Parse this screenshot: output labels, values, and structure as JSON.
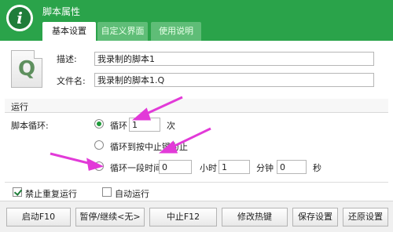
{
  "window": {
    "title": "脚本属性",
    "logo_letter": "i"
  },
  "tabs": [
    {
      "label": "基本设置",
      "active": true
    },
    {
      "label": "自定义界面",
      "active": false
    },
    {
      "label": "使用说明",
      "active": false
    }
  ],
  "script_icon": {
    "icon": "script-file-icon",
    "letter": "Q"
  },
  "desc": {
    "label": "描述:",
    "value": "我录制的脚本1"
  },
  "file": {
    "label": "文件名:",
    "value": "我录制的脚本1.Q"
  },
  "run_section": {
    "title": "运行"
  },
  "loop": {
    "label": "脚本循环:",
    "option_loop": {
      "label": "循环",
      "count": "1",
      "unit": "次",
      "selected": true
    },
    "option_until_stop": {
      "label": "循环到按中止键为止",
      "selected": false
    },
    "option_duration": {
      "label": "循环一段时间",
      "selected": false,
      "hours": "0",
      "hours_unit": "小时",
      "minutes": "1",
      "minutes_unit": "分钟",
      "seconds": "0",
      "seconds_unit": "秒"
    }
  },
  "options": {
    "no_repeat": {
      "label": "禁止重复运行",
      "checked": true
    },
    "auto_run": {
      "label": "自动运行",
      "checked": false
    }
  },
  "buttons": {
    "start": "启动F10",
    "pause": "暂停/继续<无>",
    "stop": "中止F12",
    "hotkey": "修改热键",
    "save": "保存设置",
    "restore": "还原设置"
  },
  "colors": {
    "accent": "#2aa34a",
    "arrow": "#e23ad8"
  }
}
